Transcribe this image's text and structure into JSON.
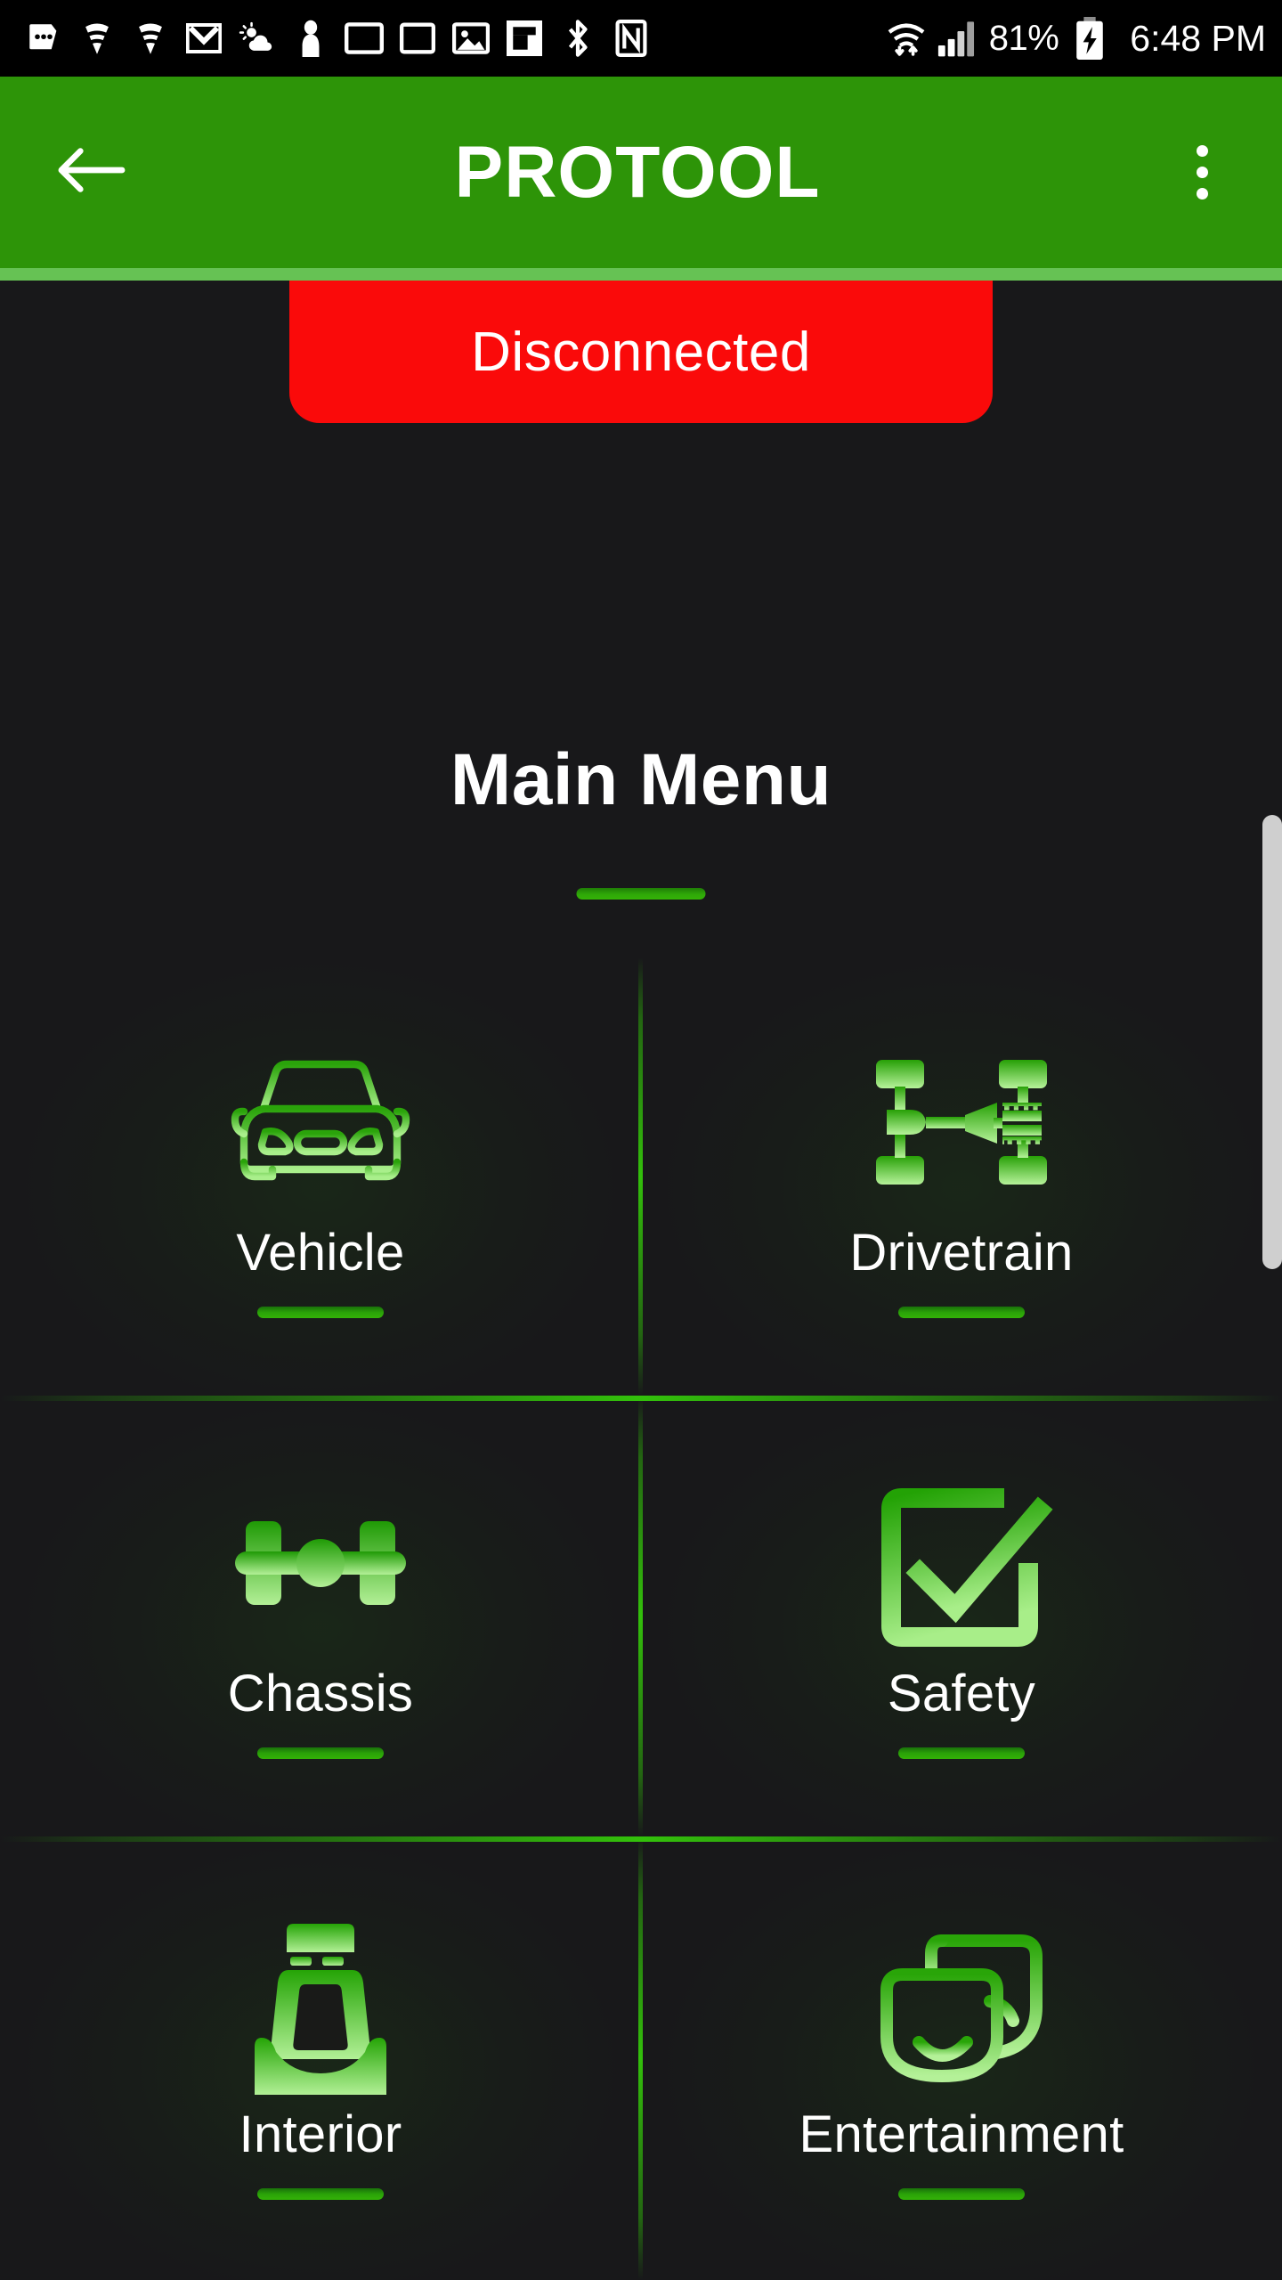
{
  "statusbar": {
    "left_icons": [
      {
        "name": "messages-icon",
        "glyph": "dots-bubble"
      },
      {
        "name": "wifi-calling-icon-1",
        "glyph": "wifi-arc"
      },
      {
        "name": "wifi-calling-icon-2",
        "glyph": "wifi-arc"
      },
      {
        "name": "gmail-icon",
        "glyph": "m-envelope"
      },
      {
        "name": "weather-icon",
        "glyph": "sun-cloud"
      },
      {
        "name": "person-icon",
        "glyph": "person"
      },
      {
        "name": "cast-screen-icon-1",
        "glyph": "monitor"
      },
      {
        "name": "cast-screen-icon-2",
        "glyph": "monitor"
      },
      {
        "name": "photos-icon",
        "glyph": "picture"
      },
      {
        "name": "flipboard-icon",
        "glyph": "flip-f"
      },
      {
        "name": "bluetooth-icon",
        "glyph": "bluetooth"
      },
      {
        "name": "nfc-icon",
        "glyph": "nfc-n"
      }
    ],
    "right_icons": [
      {
        "name": "wifi-transfer-icon",
        "glyph": "wifi-updown"
      },
      {
        "name": "cellular-signal-icon",
        "glyph": "signal-bars"
      }
    ],
    "battery_percent": "81%",
    "battery_icon": "battery-charging-icon",
    "time": "6:48 PM"
  },
  "appbar": {
    "back_icon": "back-arrow-icon",
    "title": "PROTOOL",
    "overflow_icon": "overflow-menu-icon",
    "background_color": "#2d9408",
    "accent_strip_color": "#66c254"
  },
  "connection": {
    "status_label": "Disconnected",
    "status_color": "#fa0a0a",
    "text_color": "#ffffff"
  },
  "page": {
    "title": "Main Menu",
    "background_color": "#18181a",
    "accent_green": "#2fa808"
  },
  "menu": {
    "columns": 2,
    "items": [
      {
        "id": "vehicle",
        "label": "Vehicle",
        "icon": "car-front-icon",
        "row": 0,
        "col": 0
      },
      {
        "id": "drivetrain",
        "label": "Drivetrain",
        "icon": "drivetrain-icon",
        "row": 0,
        "col": 1
      },
      {
        "id": "chassis",
        "label": "Chassis",
        "icon": "axle-icon",
        "row": 1,
        "col": 0
      },
      {
        "id": "safety",
        "label": "Safety",
        "icon": "checkbox-check-icon",
        "row": 1,
        "col": 1
      },
      {
        "id": "interior",
        "label": "Interior",
        "icon": "car-seat-icon",
        "row": 2,
        "col": 0
      },
      {
        "id": "entertainment",
        "label": "Entertainment",
        "icon": "theater-masks-icon",
        "row": 2,
        "col": 1
      }
    ]
  },
  "scrollbar": {
    "visible": true,
    "thumb_color": "#cfcfcf"
  }
}
